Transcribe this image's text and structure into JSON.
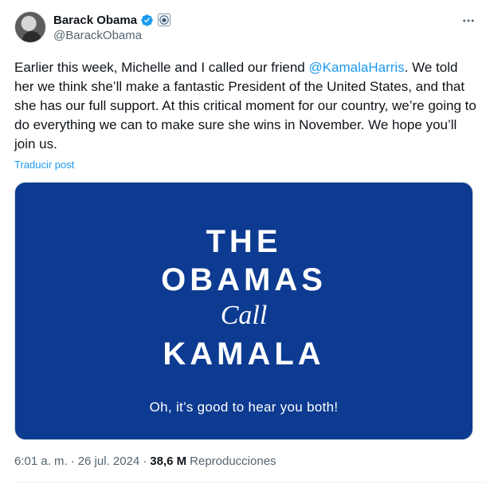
{
  "author": {
    "name": "Barack Obama",
    "handle": "@BarackObama"
  },
  "tweet": {
    "text_before": "Earlier this week, Michelle and I called our friend ",
    "mention": "@KamalaHarris",
    "text_after": ". We told her we think she’ll make a fantastic President of the United States, and that she has our full support. At this critical moment for our country, we’re going to do everything we can to make sure she wins in November. We hope you’ll join us.",
    "translate_label": "Traducir post"
  },
  "media": {
    "line1": "THE",
    "line2": "OBAMAS",
    "line3": "Call",
    "line4": "KAMALA",
    "subtitle": "Oh, it’s good to hear you both!",
    "background_color": "#0d3b91"
  },
  "meta": {
    "time": "6:01 a. m.",
    "separator": "·",
    "date": "26 jul. 2024",
    "separator2": "·",
    "views": "38,6 M",
    "views_label": "Reproducciones"
  },
  "colors": {
    "accent": "#1d9bf0",
    "secondary_text": "#536471"
  }
}
